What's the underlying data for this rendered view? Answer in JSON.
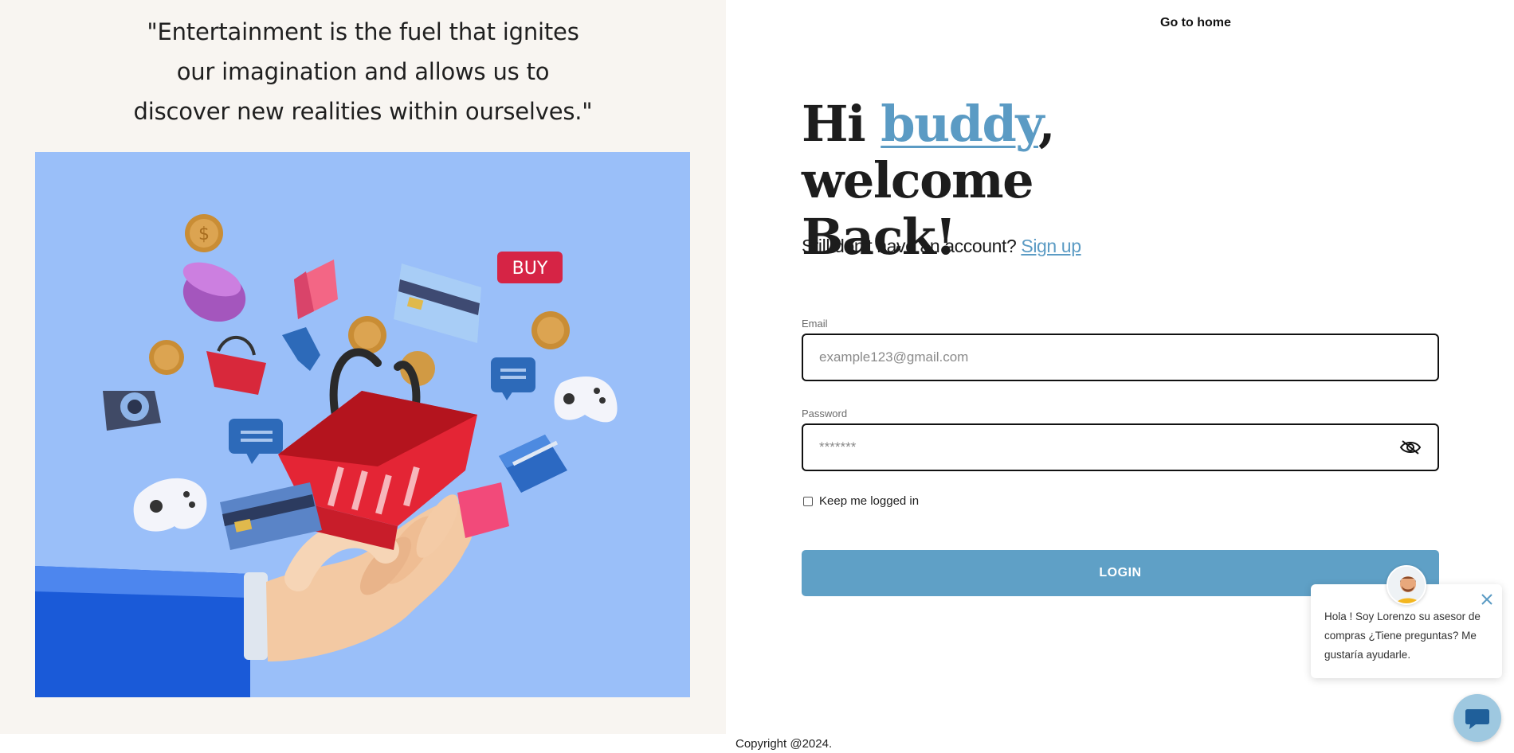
{
  "left": {
    "quote_lines": [
      "\"Entertainment is the fuel that ignites",
      "our imagination and allows us to",
      "discover new realities within ourselves.\""
    ],
    "hero": {
      "buy_label": "BUY",
      "icons": [
        "coin-icon",
        "shopping-basket-icon",
        "gamepad-icon",
        "credit-card-icon",
        "chat-bubble-icon",
        "camera-icon",
        "shopping-bag-icon",
        "gift-box-icon",
        "hand-illustration"
      ]
    }
  },
  "header": {
    "go_home": "Go to home"
  },
  "heading": {
    "hi": "Hi ",
    "accent": "buddy",
    "rest": ", welcome",
    "line2": "Back!"
  },
  "signup": {
    "prompt": "Still don't have an account? ",
    "link": "Sign up"
  },
  "form": {
    "email_label": "Email",
    "email_placeholder": "example123@gmail.com",
    "password_label": "Password",
    "password_placeholder": "*******",
    "remember_label": "Keep me logged in",
    "remember_checked": false,
    "login_label": "LOGIN"
  },
  "chat": {
    "message": "Hola ! Soy Lorenzo su asesor de compras ¿Tiene preguntas? Me gustaría ayudarle."
  },
  "footer": {
    "copyright": "Copyright @2024."
  },
  "colors": {
    "accent": "#5b9bc4",
    "login_button": "#5fa0c6",
    "left_background": "#f8f5f1",
    "hero_background": "#9abff9"
  }
}
